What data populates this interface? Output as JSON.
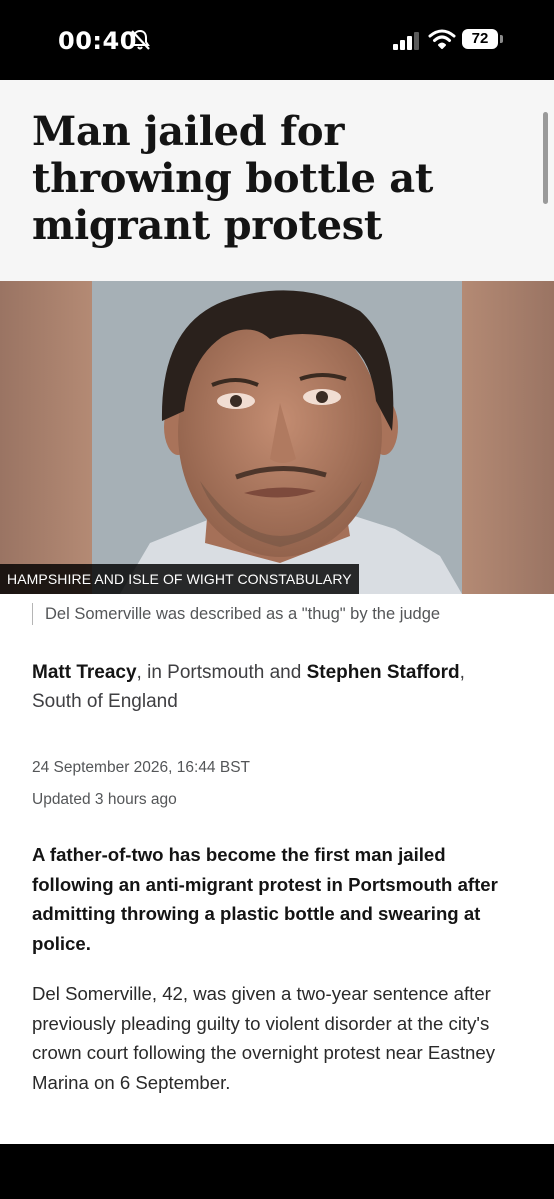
{
  "status": {
    "time": "00:40",
    "battery": "72"
  },
  "article": {
    "headline": "Man jailed for throwing bottle at migrant protest",
    "image_credit": "HAMPSHIRE AND ISLE OF WIGHT CONSTABULARY",
    "caption": "Del Somerville was described as a \"thug\" by the judge",
    "byline": {
      "author1": "Matt Treacy",
      "loc1": ", in Portsmouth and ",
      "author2": "Stephen Stafford",
      "loc2": ", South of England"
    },
    "published": "24 September 2026, 16:44 BST",
    "updated": "Updated 3 hours ago",
    "lead": "A father-of-two has become the first man jailed following an anti-migrant protest in Portsmouth after admitting throwing a plastic bottle and swearing at police.",
    "paragraph1": "Del Somerville, 42, was given a two-year sentence after previously pleading guilty to violent disorder at the city's crown court following the overnight protest near Eastney Marina on 6 September."
  },
  "icons": {
    "status": [
      "bell-slash-icon",
      "cellular-signal-icon",
      "wifi-icon",
      "battery-icon"
    ]
  }
}
